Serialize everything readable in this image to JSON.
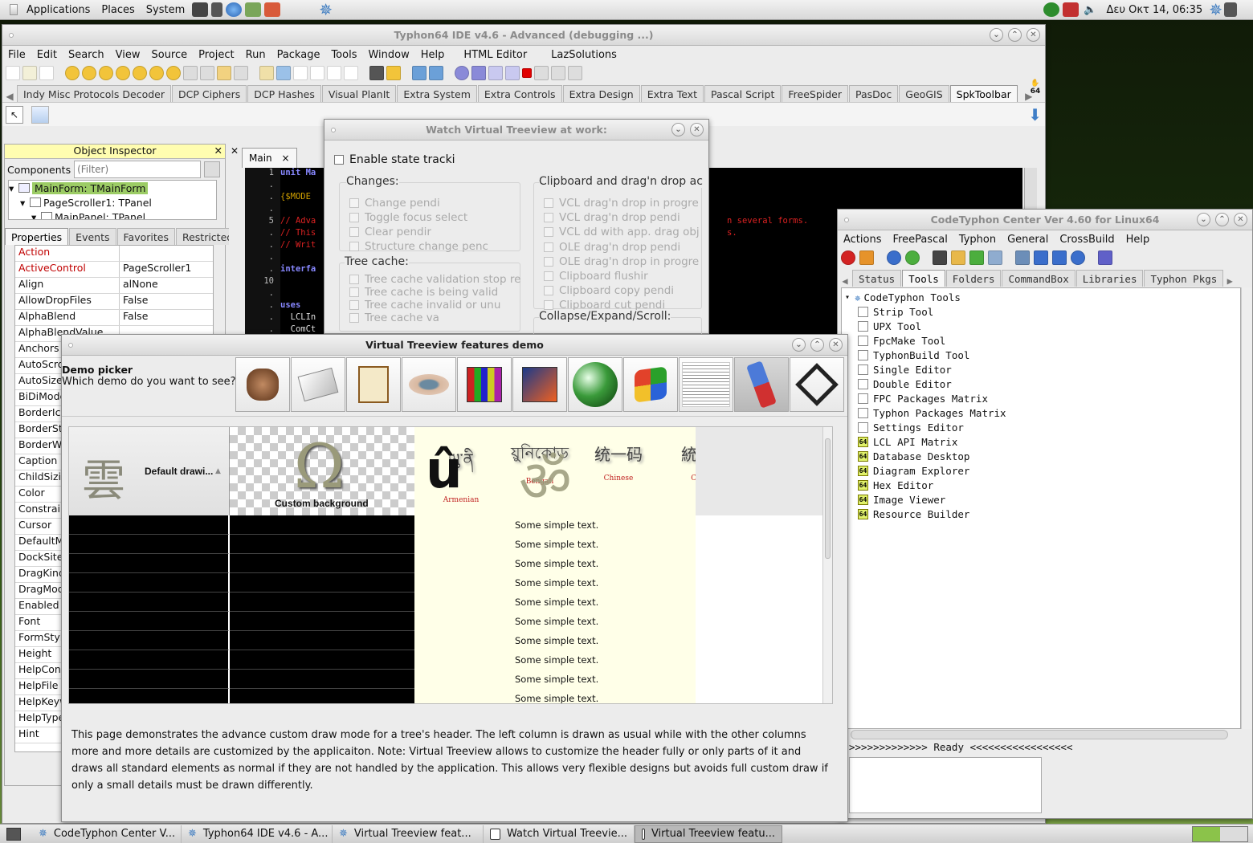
{
  "top_panel": {
    "menus": [
      "Applications",
      "Places",
      "System"
    ],
    "clock": "Δευ Οκτ 14, 06:35"
  },
  "ide": {
    "title": "Typhon64 IDE v4.6 - Advanced (debugging ...)",
    "menu": [
      "File",
      "Edit",
      "Search",
      "View",
      "Source",
      "Project",
      "Run",
      "Package",
      "Tools",
      "Window",
      "Help",
      "HTML Editor",
      "LazSolutions"
    ],
    "palette_tabs": [
      "Indy Misc Protocols Decoder",
      "DCP Ciphers",
      "DCP Hashes",
      "Visual PlanIt",
      "Extra System",
      "Extra Controls",
      "Extra Design",
      "Extra Text",
      "Pascal Script",
      "FreeSpider",
      "PasDoc",
      "GeoGIS",
      "SpkToolbar"
    ],
    "badge": "64"
  },
  "inspector": {
    "title": "Object Inspector",
    "components_label": "Components",
    "filter_placeholder": "(Filter)",
    "tree": [
      "MainForm: TMainForm",
      "PageScroller1: TPanel",
      "MainPanel: TPanel"
    ],
    "tabs": [
      "Properties",
      "Events",
      "Favorites",
      "Restricted"
    ],
    "props": [
      {
        "k": "Action",
        "v": ""
      },
      {
        "k": "ActiveControl",
        "v": "PageScroller1"
      },
      {
        "k": "Align",
        "v": "alNone"
      },
      {
        "k": "AllowDropFiles",
        "v": "False"
      },
      {
        "k": "AlphaBlend",
        "v": "False"
      },
      {
        "k": "AlphaBlendValue",
        "v": ""
      },
      {
        "k": "Anchors",
        "v": ""
      },
      {
        "k": "AutoScroll",
        "v": ""
      },
      {
        "k": "AutoSize",
        "v": ""
      },
      {
        "k": "BiDiMode",
        "v": ""
      },
      {
        "k": "BorderIcons",
        "v": ""
      },
      {
        "k": "BorderStyle",
        "v": ""
      },
      {
        "k": "BorderWidth",
        "v": ""
      },
      {
        "k": "Caption",
        "v": ""
      },
      {
        "k": "ChildSizing",
        "v": ""
      },
      {
        "k": "Color",
        "v": ""
      },
      {
        "k": "Constraints",
        "v": ""
      },
      {
        "k": "Cursor",
        "v": ""
      },
      {
        "k": "DefaultMonitor",
        "v": ""
      },
      {
        "k": "DockSite",
        "v": ""
      },
      {
        "k": "DragKind",
        "v": ""
      },
      {
        "k": "DragMode",
        "v": ""
      },
      {
        "k": "Enabled",
        "v": ""
      },
      {
        "k": "Font",
        "v": ""
      },
      {
        "k": "FormStyle",
        "v": ""
      },
      {
        "k": "Height",
        "v": ""
      },
      {
        "k": "HelpContext",
        "v": ""
      },
      {
        "k": "HelpFile",
        "v": ""
      },
      {
        "k": "HelpKeyword",
        "v": ""
      },
      {
        "k": "HelpType",
        "v": ""
      },
      {
        "k": "Hint",
        "v": ""
      }
    ]
  },
  "editor": {
    "tab": "Main",
    "lines": [
      {
        "n": "1",
        "t": "unit Ma"
      },
      {
        "n": ".",
        "t": ""
      },
      {
        "n": ".",
        "t": "{$MODE"
      },
      {
        "n": ".",
        "t": ""
      },
      {
        "n": "5",
        "t": "// Adva"
      },
      {
        "n": ".",
        "t": "// This"
      },
      {
        "n": ".",
        "t": "// Writ"
      },
      {
        "n": ".",
        "t": ""
      },
      {
        "n": ".",
        "t": "interfa"
      },
      {
        "n": "10",
        "t": ""
      },
      {
        "n": ".",
        "t": ""
      },
      {
        "n": ".",
        "t": "uses"
      },
      {
        "n": ".",
        "t": "  LCLIn"
      },
      {
        "n": ".",
        "t": "  ComCt"
      }
    ],
    "comment1": "n several forms.",
    "comment2": "s."
  },
  "watch": {
    "title": "Watch Virtual Treeview at work:",
    "enable": "Enable state tracki",
    "changes_title": "Changes:",
    "changes": [
      "Change pendi",
      "Toggle focus select",
      "Clear pendir",
      "Structure change penc"
    ],
    "cache_title": "Tree cache:",
    "cache": [
      "Tree cache validation stop re",
      "Tree cache is being valid",
      "Tree cache invalid or unu",
      "Tree cache va"
    ],
    "clip_title": "Clipboard and drag'n drop ac",
    "clip": [
      "VCL drag'n drop in progre",
      "VCL drag'n drop pendi",
      "VCL dd with app. drag obj",
      "OLE drag'n drop pendi",
      "OLE drag'n drop in progre",
      "Clipboard flushir",
      "Clipboard copy pendi",
      "Clipboard cut pendi"
    ],
    "collapse_title": "Collapse/Expand/Scroll:"
  },
  "demo": {
    "title": "Virtual Treeview features demo",
    "picker_title": "Demo picker",
    "picker_question": "Which demo do you want to see?",
    "header_default": "Default drawi...",
    "header_custom": "Custom background",
    "scripts": [
      {
        "glyph": "ཡུ་ནི",
        "label": "Armenian"
      },
      {
        "glyph": "য়ুনিকোড",
        "label": "Bengali"
      },
      {
        "glyph": "统一码",
        "label": "Chinese"
      },
      {
        "glyph": "統一",
        "label": "Chi"
      }
    ],
    "row_text": "Some simple text.",
    "row_count": 10,
    "description": "This page demonstrates the advance custom draw mode for a tree's header. The left column is drawn as usual while with the other columns more and more details are customized by the applicaiton. Note: Virtual Treeview allows to customize the header fully or only parts of it and draws all standard elements as normal if they are not handled by the application. This allows very flexible designs but avoids full custom draw if only a small details must be drawn differently."
  },
  "center": {
    "title": "CodeTyphon Center Ver 4.60 for Linux64",
    "menu": [
      "Actions",
      "FreePascal",
      "Typhon",
      "General",
      "CrossBuild",
      "Help"
    ],
    "tabs": [
      "Status",
      "Tools",
      "Folders",
      "CommandBox",
      "Libraries",
      "Typhon Pkgs"
    ],
    "root": "CodeTyphon Tools",
    "items": [
      {
        "label": "Strip Tool",
        "b64": false
      },
      {
        "label": "UPX Tool",
        "b64": false
      },
      {
        "label": "FpcMake Tool",
        "b64": false
      },
      {
        "label": "TyphonBuild Tool",
        "b64": false
      },
      {
        "label": "Single Editor",
        "b64": false
      },
      {
        "label": "Double Editor",
        "b64": false
      },
      {
        "label": "FPC Packages Matrix",
        "b64": false
      },
      {
        "label": "Typhon Packages Matrix",
        "b64": false
      },
      {
        "label": "Settings Editor",
        "b64": false
      },
      {
        "label": "LCL API Matrix",
        "b64": true
      },
      {
        "label": "Database Desktop",
        "b64": true
      },
      {
        "label": "Diagram Explorer",
        "b64": true
      },
      {
        "label": "Hex Editor",
        "b64": true
      },
      {
        "label": "Image Viewer",
        "b64": true
      },
      {
        "label": "Resource Builder",
        "b64": true
      }
    ],
    "status": ">>>>>>>>>>>>> Ready <<<<<<<<<<<<<<<<<"
  },
  "taskbar": [
    "CodeTyphon Center V...",
    "Typhon64 IDE v4.6 - A...",
    "Virtual Treeview feat...",
    "Watch Virtual Treevie...",
    "Virtual Treeview featu..."
  ],
  "colors": {
    "selection": "#9ccc65",
    "inspector_title": "#fffdb0",
    "code_bg": "#000000",
    "comment": "#dd2222",
    "keyword": "#7777ff",
    "cream": "#ffffe8"
  }
}
